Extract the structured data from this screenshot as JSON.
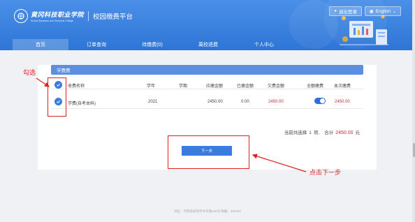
{
  "header": {
    "logo_cn": "黄冈科技职业学院",
    "logo_en": "School Business and Technical College",
    "platform_title": "校园缴费平台",
    "logout_label": "退出登录",
    "language_label": "English",
    "nav": [
      {
        "label": "首页",
        "active": true
      },
      {
        "label": "订单查询",
        "active": false
      },
      {
        "label": "待缴费(0)",
        "active": false
      },
      {
        "label": "离校退费",
        "active": false
      },
      {
        "label": "个人中心",
        "active": false
      }
    ]
  },
  "card": {
    "title": "学费费",
    "columns": [
      "收费名称",
      "学年",
      "学期",
      "应缴金额",
      "已缴金额",
      "欠费金额",
      "全额缴费",
      "本次缴费"
    ],
    "row": {
      "name": "学费(自考本科)",
      "year": "2021",
      "term": "",
      "due": "2450.00",
      "paid": "0.00",
      "owed": "2450.00",
      "full_pay_toggle": true,
      "this_pay": "2450.00",
      "checked": true
    },
    "summary": {
      "prefix": "当前共选择",
      "count": "1",
      "count_suffix": "项,",
      "total_label": "合计",
      "total_amount": "2450.00",
      "unit": "元"
    },
    "next_button": "下一步"
  },
  "annotations": {
    "check_label": "勾选",
    "next_label": "点击下一步",
    "color": "#e02020"
  },
  "footer": "地址：河南省安阳市中华路348号 邮编：455000",
  "colors": {
    "header_blue": "#2e75d6",
    "accent": "#3a7be0",
    "amount_red": "#c0303a"
  }
}
